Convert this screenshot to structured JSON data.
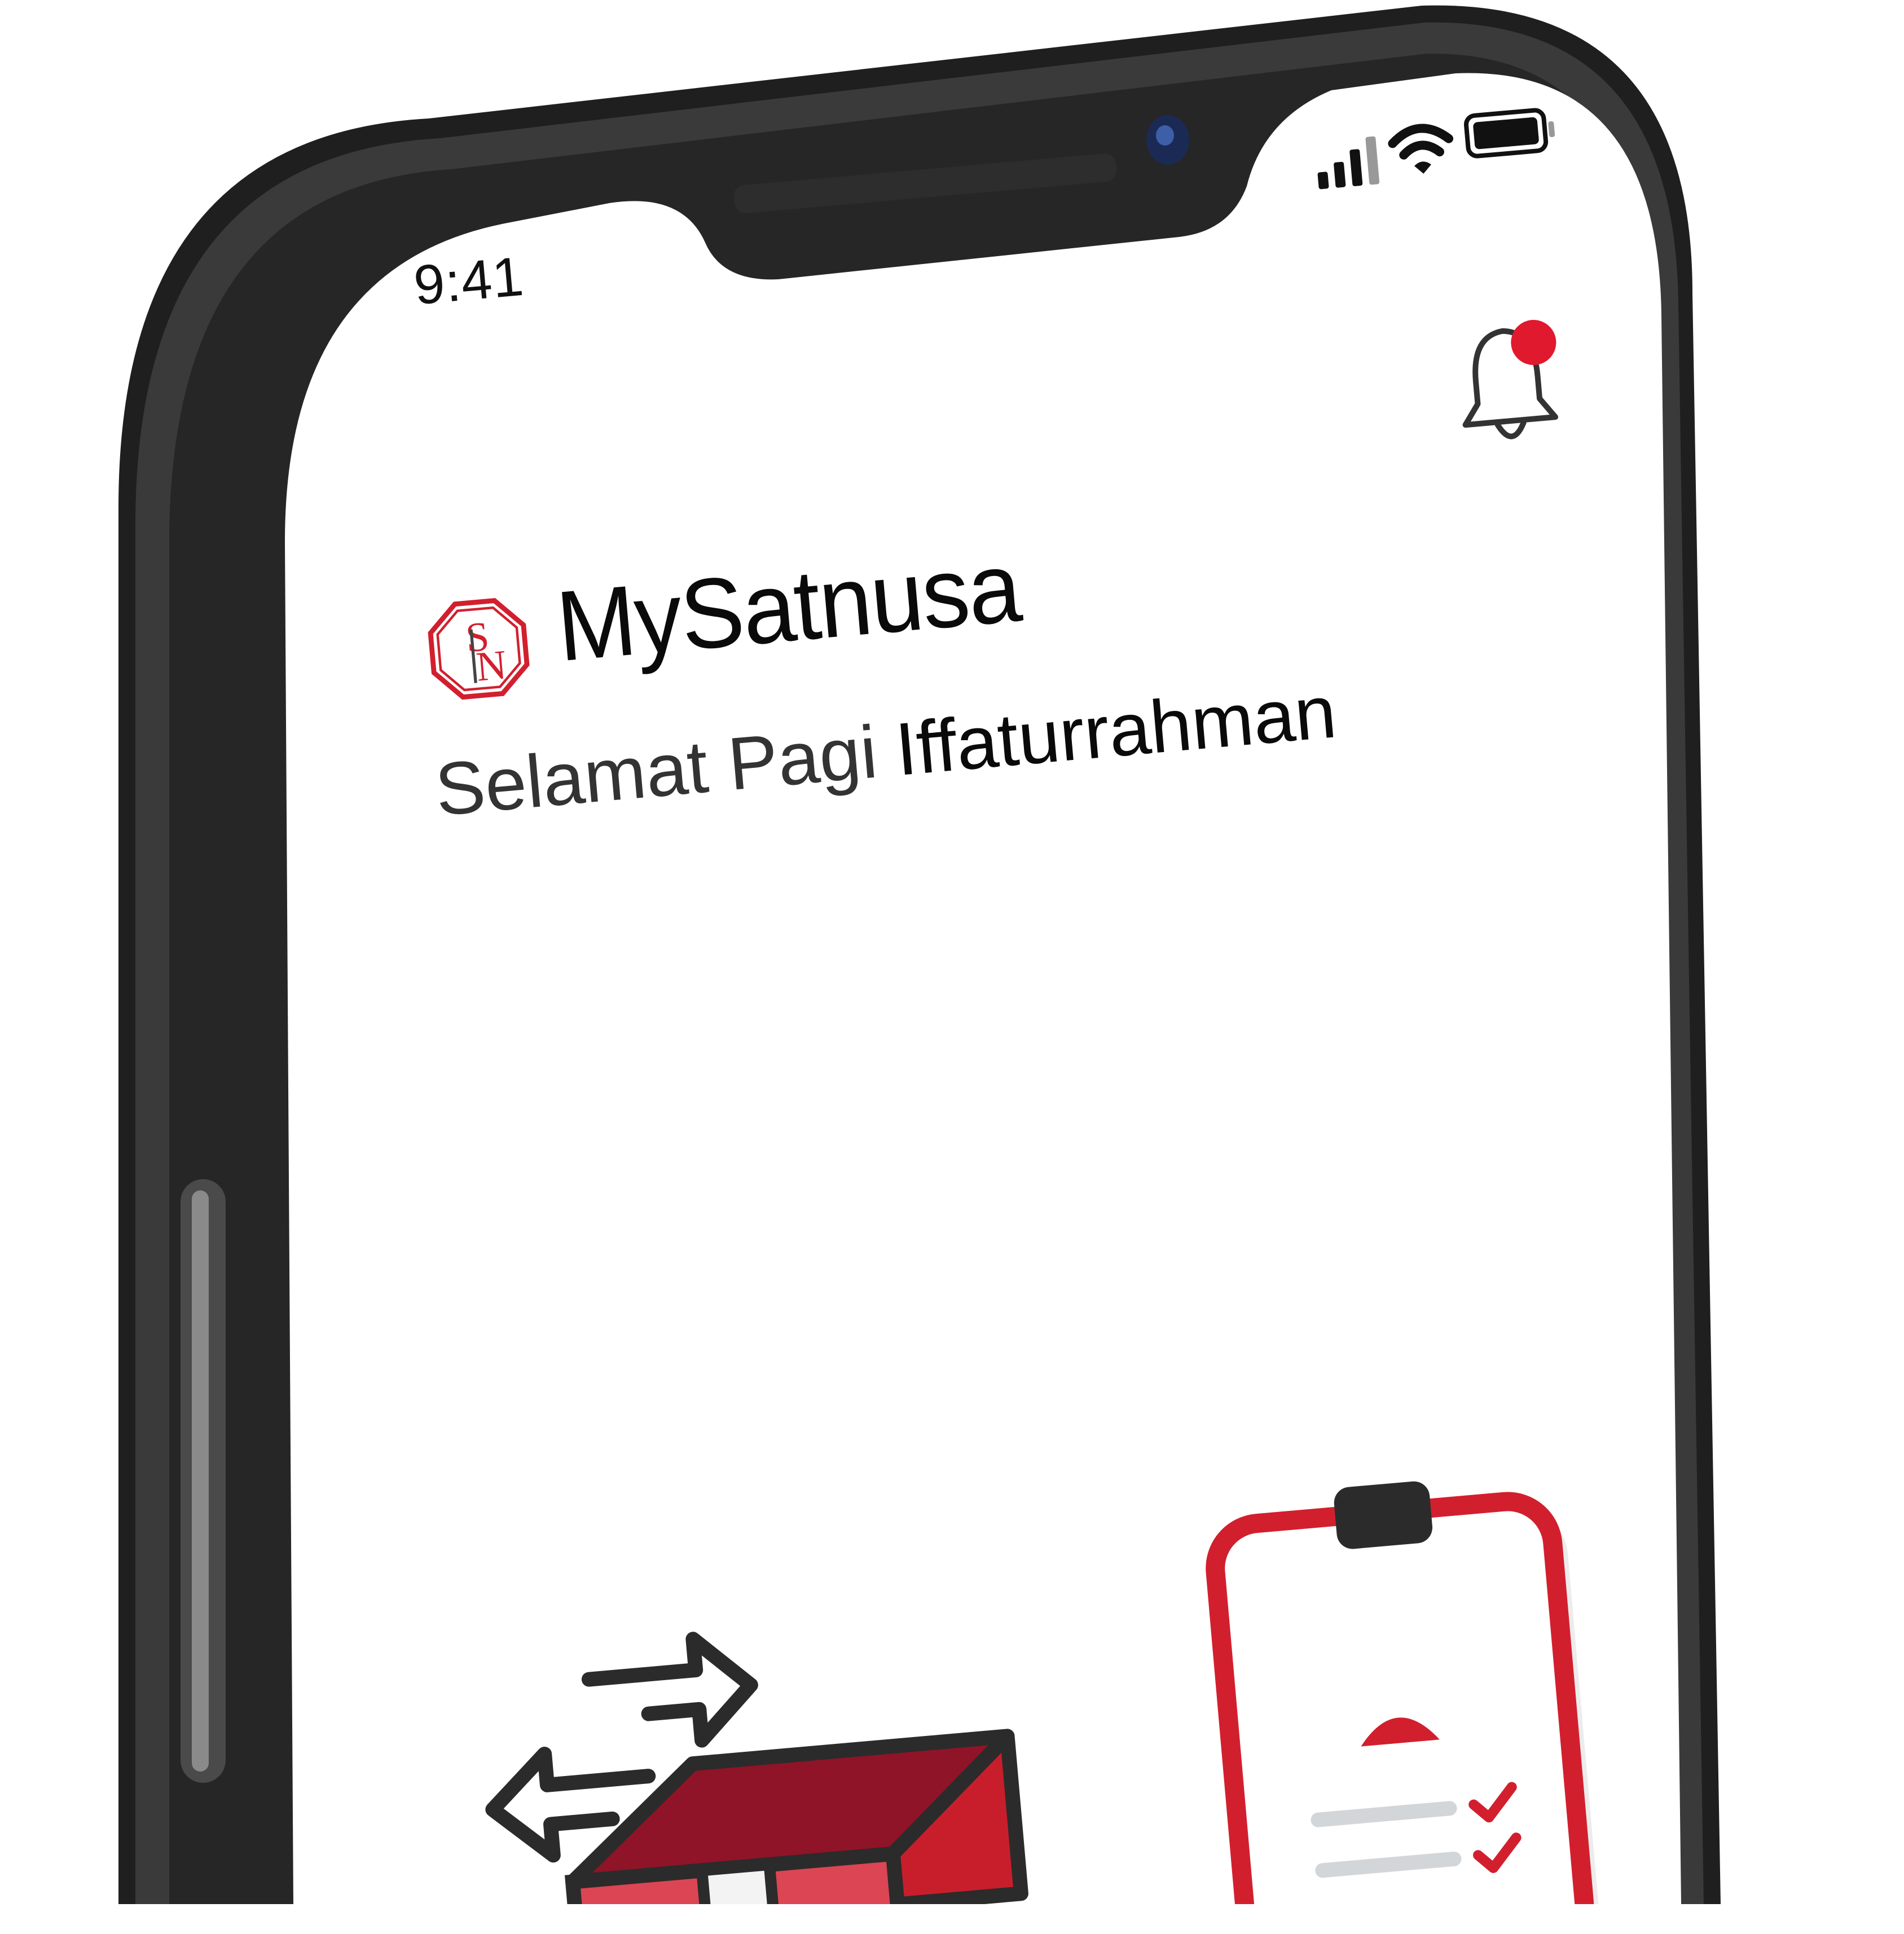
{
  "status_bar": {
    "time": "9:41",
    "icons": [
      "cellular-signal-icon",
      "wifi-icon",
      "battery-icon"
    ]
  },
  "header": {
    "logo_icon": "satnusa-logo-icon",
    "app_title": "MySatnusa",
    "notification_icon": "bell-icon",
    "notification_badge_color": "#e0192e"
  },
  "greeting": {
    "salutation": "Selamat Pagi",
    "user_name": "Iffaturrahman"
  },
  "menu_illustrations": [
    {
      "icon": "box-transfer-icon"
    },
    {
      "icon": "clipboard-checklist-icon"
    }
  ],
  "colors": {
    "brand_red": "#d21f2e",
    "dark_red": "#8f1427",
    "phone_frame": "#2b2b2b"
  }
}
